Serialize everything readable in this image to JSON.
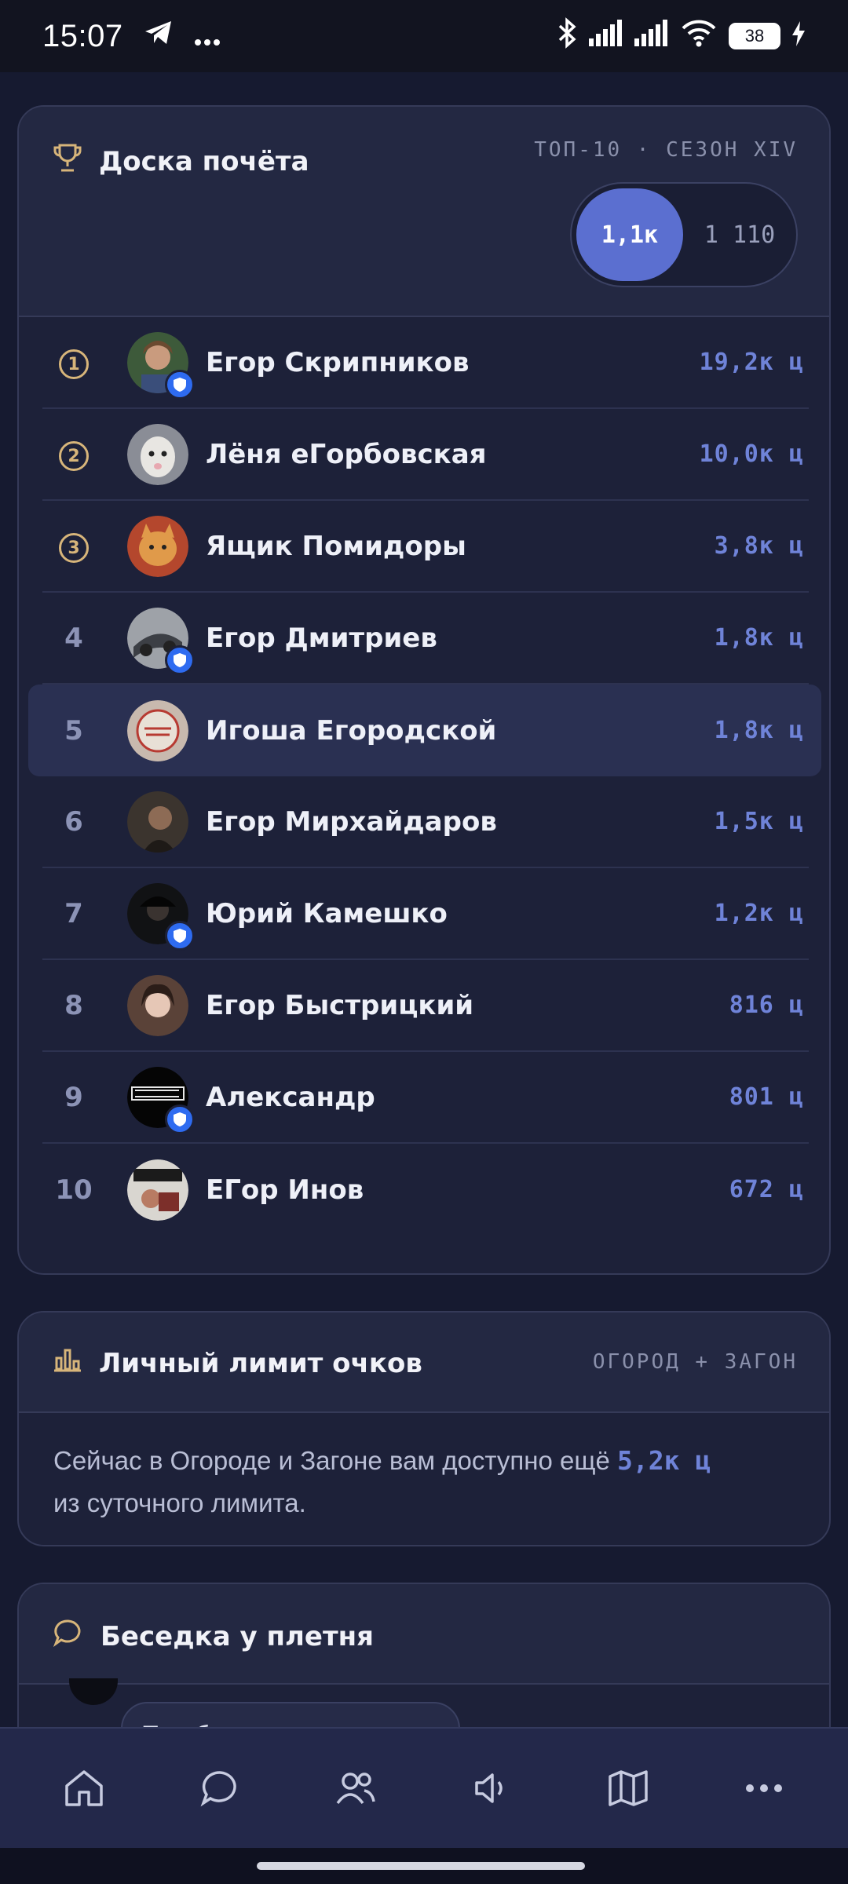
{
  "status_bar": {
    "time": "15:07",
    "battery": "38",
    "icons": [
      "telegram-icon",
      "more-dots-icon",
      "bluetooth-icon",
      "signal-icon",
      "signal-icon",
      "wifi-icon",
      "battery-icon",
      "charging-icon"
    ]
  },
  "leaderboard": {
    "title": "Доска почёта",
    "meta": "ТОП-10 · СЕЗОН XIV",
    "toggle": {
      "active": "1,1к",
      "inactive": "1 110"
    },
    "rows": [
      {
        "rank": "1",
        "name": "Егор Скрипников",
        "score": "19,2к ц",
        "verified": true
      },
      {
        "rank": "2",
        "name": "Лёня еГорбовская",
        "score": "10,0к ц",
        "verified": false
      },
      {
        "rank": "3",
        "name": "Ящик Помидоры",
        "score": "3,8к ц",
        "verified": false
      },
      {
        "rank": "4",
        "name": "Егор Дмитриев",
        "score": "1,8к ц",
        "verified": true
      },
      {
        "rank": "5",
        "name": "Игоша Егородской",
        "score": "1,8к ц",
        "verified": false
      },
      {
        "rank": "6",
        "name": "Егор Мирхайдаров",
        "score": "1,5к ц",
        "verified": false
      },
      {
        "rank": "7",
        "name": "Юрий Камешко",
        "score": "1,2к ц",
        "verified": true
      },
      {
        "rank": "8",
        "name": "Егор Быстрицкий",
        "score": "816 ц",
        "verified": false
      },
      {
        "rank": "9",
        "name": "Александр",
        "score": "801 ц",
        "verified": true
      },
      {
        "rank": "10",
        "name": "ЕГор Инов",
        "score": "672 ц",
        "verified": false
      }
    ]
  },
  "limit": {
    "title": "Личный лимит очков",
    "meta": "ОГОРОД + ЗАГОН",
    "text_before": "Сейчас в Огороде и Загоне вам доступно ещё",
    "value": "5,2к ц",
    "text_after": "из суточного лимита."
  },
  "chat": {
    "title": "Беседка у плетня",
    "message": "Тем более ты не знал"
  },
  "nav": [
    "home-icon",
    "chat-icon",
    "people-icon",
    "megaphone-icon",
    "map-icon",
    "more-icon"
  ],
  "colors": {
    "background": "#161a30",
    "card": "#1d2139",
    "accent": "#5b6fd0",
    "score": "#6f83d8",
    "medal": "#d7b57a",
    "verified": "#2e6bf0"
  }
}
